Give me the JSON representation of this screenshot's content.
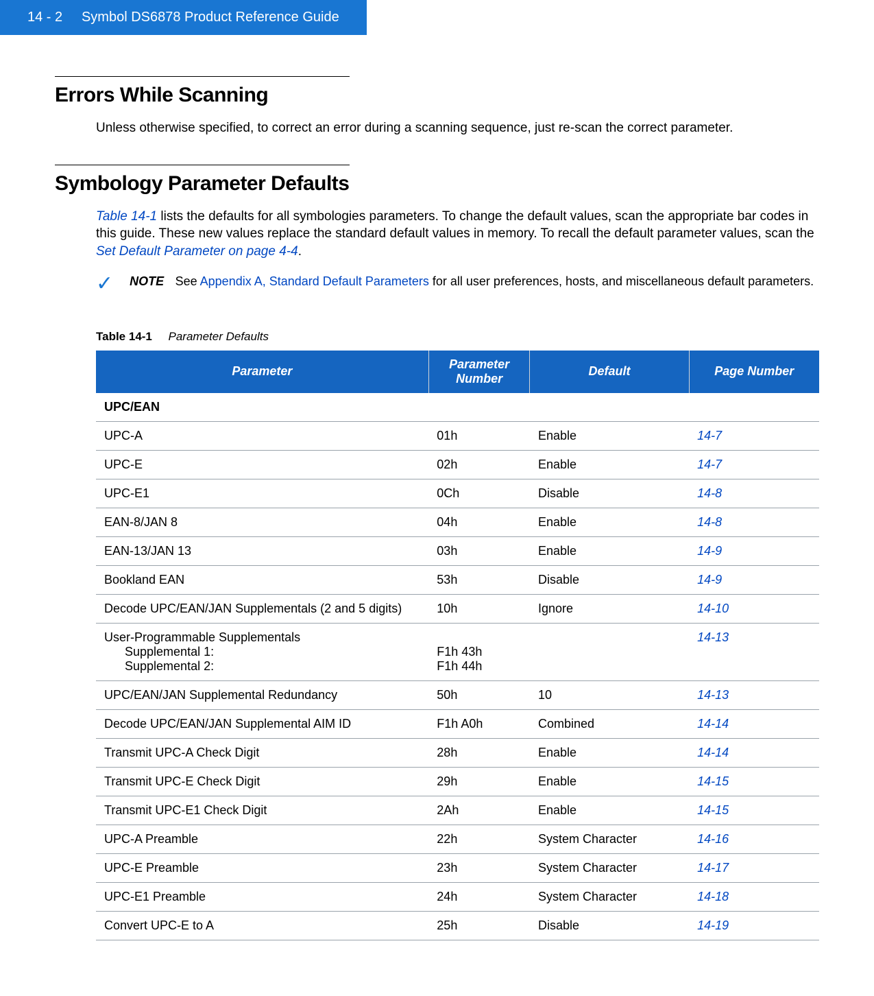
{
  "header": {
    "page_ref": "14 - 2",
    "doc_title": "Symbol DS6878 Product Reference Guide"
  },
  "section1": {
    "title": "Errors While Scanning",
    "body": "Unless otherwise specified, to correct an error during a scanning sequence, just re-scan the correct parameter."
  },
  "section2": {
    "title": "Symbology Parameter Defaults",
    "body_pre": "Table 14-1",
    "body_mid": " lists the defaults for all symbologies parameters. To change the default values, scan the appropriate bar codes in this guide. These new values replace the standard default values in memory. To recall the default parameter values, scan the ",
    "body_link2": "Set Default Parameter on page 4-4",
    "body_post": "."
  },
  "note": {
    "label": "NOTE",
    "pre": "See ",
    "link": "Appendix A, Standard Default Parameters",
    "post": " for all user preferences, hosts, and miscellaneous default parameters."
  },
  "table": {
    "caption_label": "Table 14-1",
    "caption_desc": "Parameter Defaults",
    "headers": {
      "c1": "Parameter",
      "c2": "Parameter Number",
      "c3": "Default",
      "c4": "Page Number"
    },
    "section_header": "UPC/EAN",
    "rows": [
      {
        "p": "UPC-A",
        "n": "01h",
        "d": "Enable",
        "pg": "14-7"
      },
      {
        "p": "UPC-E",
        "n": "02h",
        "d": "Enable",
        "pg": "14-7"
      },
      {
        "p": "UPC-E1",
        "n": "0Ch",
        "d": "Disable",
        "pg": "14-8"
      },
      {
        "p": "EAN-8/JAN 8",
        "n": "04h",
        "d": "Enable",
        "pg": "14-8"
      },
      {
        "p": "EAN-13/JAN 13",
        "n": "03h",
        "d": "Enable",
        "pg": "14-9"
      },
      {
        "p": "Bookland EAN",
        "n": "53h",
        "d": "Disable",
        "pg": "14-9"
      },
      {
        "p": "Decode UPC/EAN/JAN Supplementals (2 and 5 digits)",
        "n": "10h",
        "d": "Ignore",
        "pg": "14-10"
      }
    ],
    "multi_row": {
      "p_line1": "User-Programmable Supplementals",
      "p_sub1": "Supplemental 1:",
      "p_sub2": "Supplemental 2:",
      "n_line1": "",
      "n_line2": "F1h 43h",
      "n_line3": "F1h 44h",
      "d": "",
      "pg": "14-13"
    },
    "rows2": [
      {
        "p": "UPC/EAN/JAN Supplemental Redundancy",
        "n": "50h",
        "d": "10",
        "pg": "14-13"
      },
      {
        "p": "Decode UPC/EAN/JAN Supplemental AIM ID",
        "n": "F1h A0h",
        "d": "Combined",
        "pg": "14-14"
      },
      {
        "p": "Transmit UPC-A Check Digit",
        "n": "28h",
        "d": "Enable",
        "pg": "14-14"
      },
      {
        "p": "Transmit UPC-E Check Digit",
        "n": "29h",
        "d": "Enable",
        "pg": "14-15"
      },
      {
        "p": "Transmit UPC-E1 Check Digit",
        "n": "2Ah",
        "d": "Enable",
        "pg": "14-15"
      },
      {
        "p": "UPC-A Preamble",
        "n": "22h",
        "d": "System Character",
        "pg": "14-16"
      },
      {
        "p": "UPC-E Preamble",
        "n": "23h",
        "d": "System Character",
        "pg": "14-17"
      },
      {
        "p": "UPC-E1 Preamble",
        "n": "24h",
        "d": "System Character",
        "pg": "14-18"
      },
      {
        "p": "Convert UPC-E to A",
        "n": "25h",
        "d": "Disable",
        "pg": "14-19"
      }
    ]
  }
}
